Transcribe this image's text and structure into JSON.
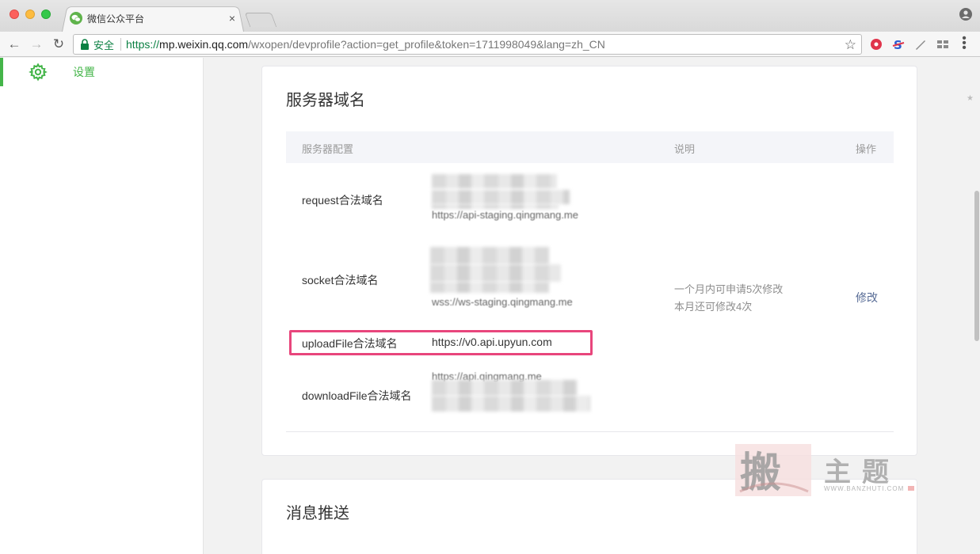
{
  "browser": {
    "tab_title": "微信公众平台",
    "tab_close": "×",
    "secure_label": "安全",
    "url_scheme": "https://",
    "url_host": "mp.weixin.qq.com",
    "url_path": "/wxopen/devprofile?action=get_profile&token=1711998049&lang=zh_CN",
    "icons": {
      "back": "back-arrow-icon",
      "forward": "forward-arrow-icon",
      "reload": "reload-icon",
      "lock": "lock-icon",
      "star": "star-icon",
      "menu": "menu-dots-icon",
      "profile": "profile-icon"
    },
    "accent_secure": "#0b8043"
  },
  "sidebar": {
    "items": [
      {
        "label": "设置",
        "icon": "gear-icon",
        "active": true
      }
    ],
    "accent": "#44b549"
  },
  "server_domains": {
    "title": "服务器域名",
    "columns": [
      "服务器配置",
      "说明",
      "操作"
    ],
    "rows": [
      {
        "label": "request合法域名",
        "value_visible": "https://api-staging.qingmang.me",
        "obscured": true
      },
      {
        "label": "socket合法域名",
        "value_visible": "wss://ws-staging.qingmang.me",
        "obscured": true
      },
      {
        "label": "uploadFile合法域名",
        "value_visible": "https://v0.api.upyun.com",
        "obscured": false,
        "highlighted": true
      },
      {
        "label": "downloadFile合法域名",
        "value_visible": "https://api.qingmang.me",
        "obscured": true
      }
    ],
    "description_lines": [
      "一个月内可申请5次修改",
      "本月还可修改4次"
    ],
    "action_label": "修改",
    "highlight_color": "#e8467c",
    "link_color": "#576b95"
  },
  "message_push": {
    "title": "消息推送"
  },
  "watermark": {
    "chars": "主题",
    "url": "WWW.BANZHUTI.COM"
  }
}
